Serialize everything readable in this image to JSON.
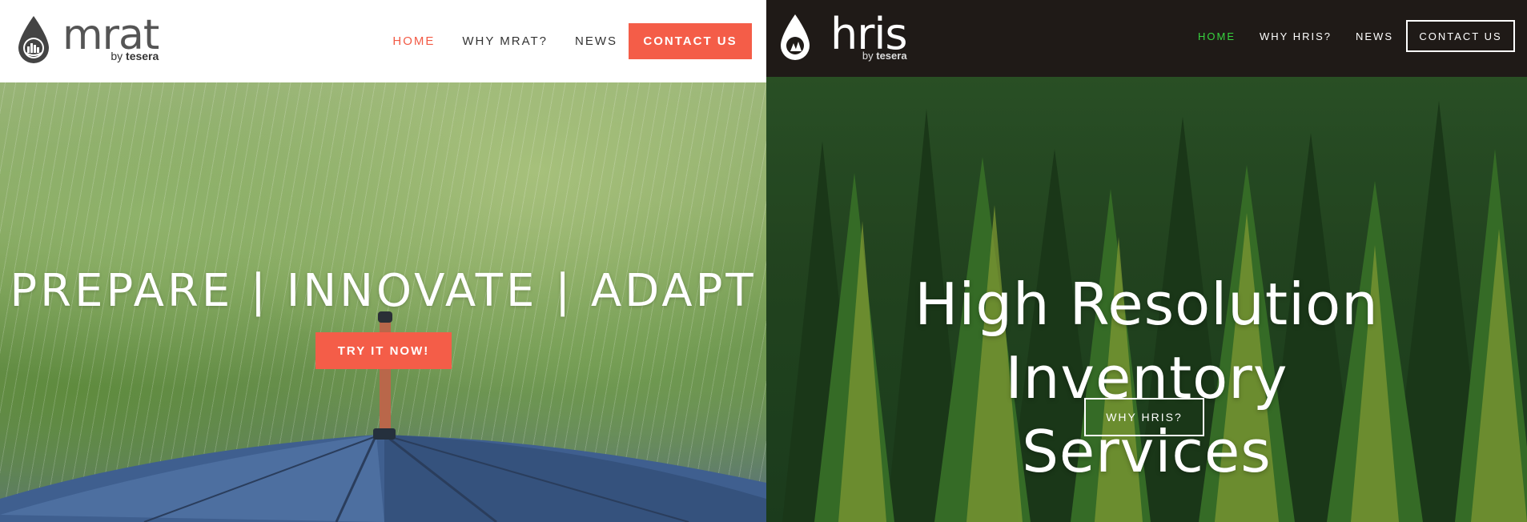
{
  "left": {
    "logo": {
      "name": "mrat",
      "by_prefix": "by",
      "by_brand": "tesera"
    },
    "nav": [
      {
        "label": "HOME",
        "active": true
      },
      {
        "label": "WHY MRAT?",
        "active": false
      },
      {
        "label": "NEWS",
        "active": false
      }
    ],
    "contact_label": "CONTACT US",
    "hero": {
      "headline": "PREPARE | INNOVATE | ADAPT",
      "cta_label": "TRY IT NOW!"
    },
    "colors": {
      "accent": "#f45d48",
      "header_bg": "#ffffff"
    }
  },
  "right": {
    "logo": {
      "name": "hris",
      "by_prefix": "by",
      "by_brand": "tesera"
    },
    "nav": [
      {
        "label": "HOME",
        "active": true
      },
      {
        "label": "WHY HRIS?",
        "active": false
      },
      {
        "label": "NEWS",
        "active": false
      }
    ],
    "contact_label": "CONTACT US",
    "hero": {
      "headline_line1": "High Resolution Inventory",
      "headline_line2": "Services",
      "cta_label": "WHY HRIS?"
    },
    "colors": {
      "active_nav": "#37d43f",
      "header_bg": "#1f1a17"
    }
  },
  "icons": {
    "left_logo": "water-drop-city-icon",
    "right_logo": "water-drop-trees-icon"
  }
}
